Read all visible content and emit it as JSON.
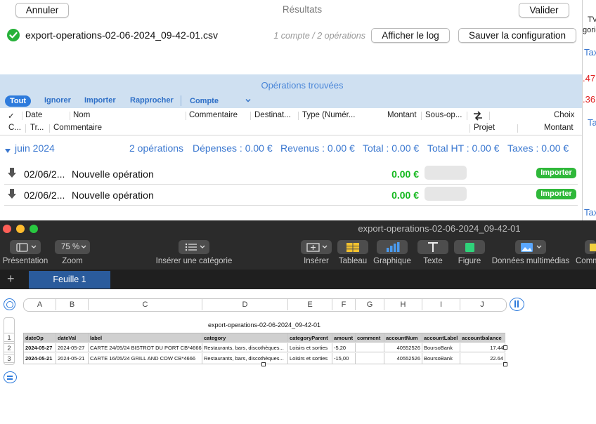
{
  "dialog": {
    "cancel_label": "Annuler",
    "title": "Résultats",
    "validate_label": "Valider",
    "file_name": "export-operations-02-06-2024_09-42-01.csv",
    "file_meta": "1 compte / 2 opérations",
    "show_log_label": "Afficher le log",
    "save_config_label": "Sauver la configuration",
    "ops_title": "Opérations trouvées",
    "filters": {
      "all": "Tout",
      "ignore": "Ignorer",
      "import": "Importer",
      "reconcile": "Rapprocher",
      "account": "Compte"
    },
    "header1": {
      "check": "✓",
      "date": "Date",
      "name": "Nom",
      "comment": "Commentaire",
      "recipient": "Destinat...",
      "type": "Type (Numér...",
      "amount": "Montant",
      "subop": "Sous-op...",
      "choice": "Choix"
    },
    "header2": {
      "c": "C...",
      "tr": "Tr...",
      "comment": "Commentaire",
      "project": "Projet",
      "amount": "Montant"
    },
    "month": {
      "label": "juin 2024",
      "ops": "2 opérations",
      "expenses": "Dépenses : 0.00 €",
      "revenue": "Revenus : 0.00 €",
      "total": "Total : 0.00 €",
      "total_ht": "Total HT : 0.00 €",
      "taxes": "Taxes : 0.00 €"
    },
    "operations": [
      {
        "date": "02/06/2...",
        "name": "Nouvelle opération",
        "amount": "0.00 €",
        "action": "Importer"
      },
      {
        "date": "02/06/2...",
        "name": "Nouvelle opération",
        "amount": "0.00 €",
        "action": "Importer"
      }
    ]
  },
  "right_panel": {
    "t1": "TV",
    "t2": "gorie",
    "t3": "Tax",
    "n1": ".47",
    "n2": ".36",
    "t4": "Tax",
    "t5": "Tax"
  },
  "numbers": {
    "window_title": "export-operations-02-06-2024_09-42-01",
    "toolbar": {
      "presentation": "Présentation",
      "zoom": "Zoom",
      "zoom_value": "75 %",
      "insert_category": "Insérer une catégorie",
      "insert": "Insérer",
      "table": "Tableau",
      "chart": "Graphique",
      "text": "Texte",
      "shape": "Figure",
      "media": "Données multimédias",
      "comment": "Comm"
    },
    "sheet_tab": "Feuille 1",
    "add_sheet": "+",
    "columns": [
      "A",
      "B",
      "C",
      "D",
      "E",
      "F",
      "G",
      "H",
      "I",
      "J"
    ],
    "table_title": "export-operations-02-06-2024_09-42-01",
    "row_numbers": [
      "1",
      "2",
      "3"
    ],
    "headers": [
      "dateOp",
      "dateVal",
      "label",
      "category",
      "categoryParent",
      "amount",
      "comment",
      "accountNum",
      "accountLabel",
      "accountbalance"
    ],
    "rows": [
      [
        "2024-05-27",
        "2024-05-27",
        "CARTE 24/05/24 BISTROT DU PORT CB*4666",
        "Restaurants, bars, discothèques...",
        "Loisirs et sorties",
        "-5,20",
        "",
        "40552526",
        "BoursoBank",
        "17.44"
      ],
      [
        "2024-05-21",
        "2024-05-21",
        "CARTE 16/05/24 GRILL AND COW CB*4666",
        "Restaurants, bars, discothèques...",
        "Loisirs et sorties",
        "-15,00",
        "",
        "40552526",
        "BoursoBank",
        "22.64"
      ]
    ]
  },
  "colors": {
    "accent_blue": "#2e7bdc",
    "success_green": "#2fb83a",
    "numbers_tab": "#2a5b9c"
  }
}
